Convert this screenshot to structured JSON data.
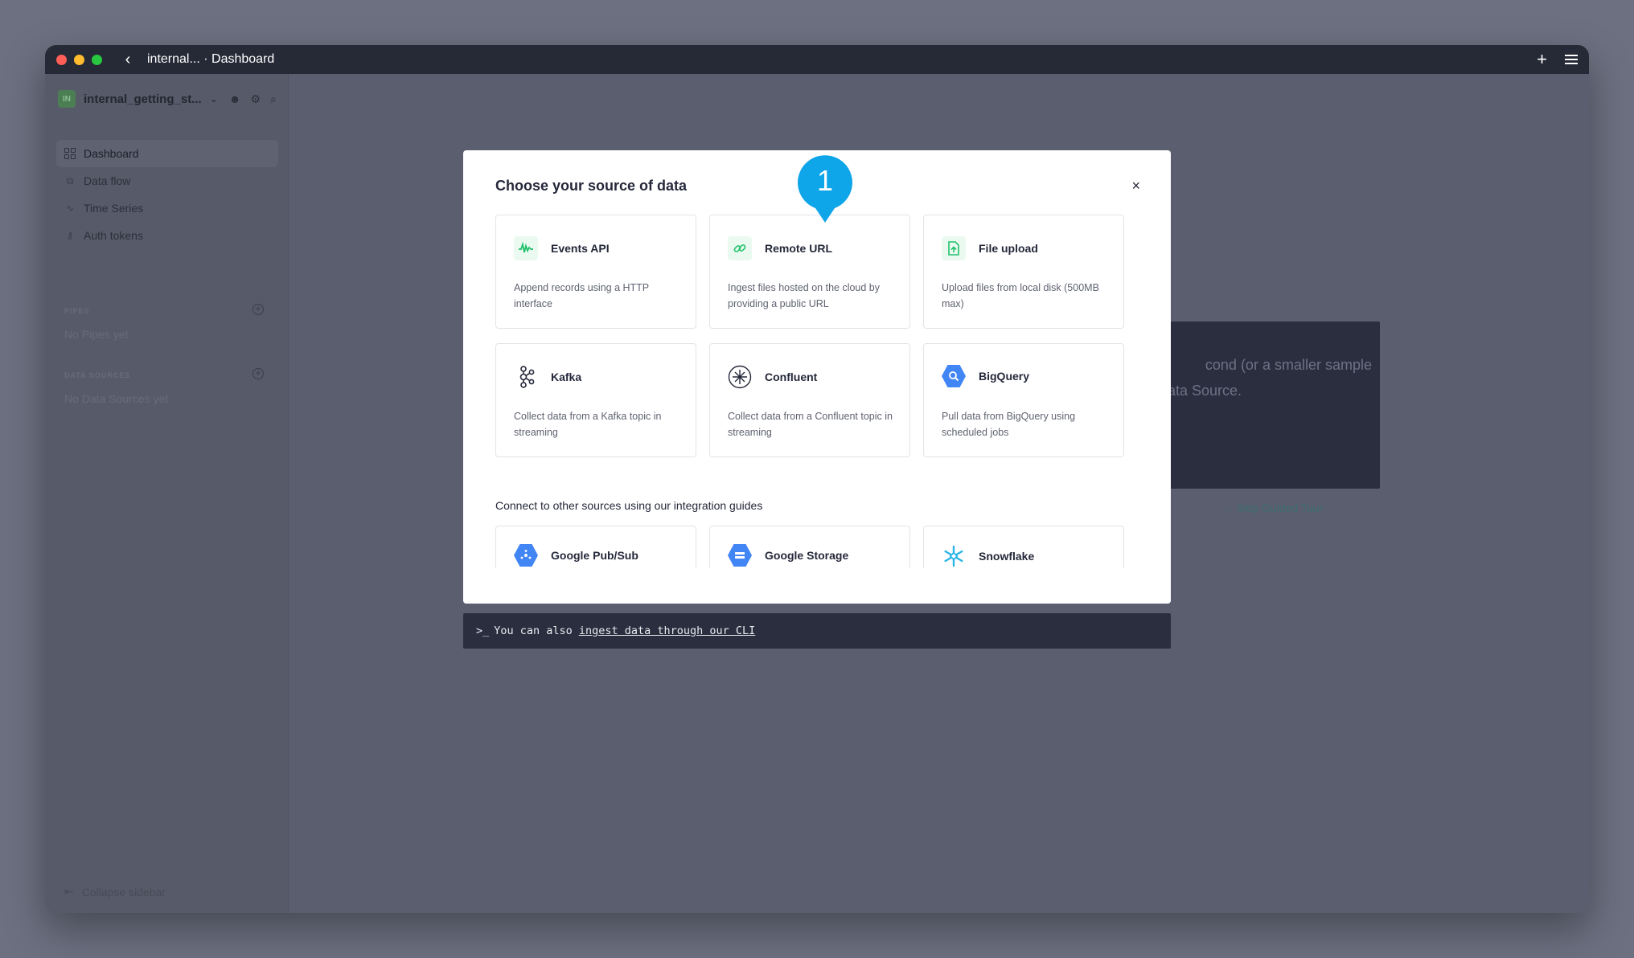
{
  "window": {
    "title": "internal... · Dashboard"
  },
  "sidebar": {
    "workspace_badge": "IN",
    "workspace_name": "internal_getting_st...",
    "nav": [
      {
        "label": "Dashboard",
        "icon": "dashboard-icon"
      },
      {
        "label": "Data flow",
        "icon": "data-flow-icon"
      },
      {
        "label": "Time Series",
        "icon": "time-series-icon"
      },
      {
        "label": "Auth tokens",
        "icon": "auth-tokens-icon"
      }
    ],
    "pipes_heading": "PIPES",
    "pipes_empty": "No Pipes yet",
    "datasources_heading": "DATA SOURCES",
    "datasources_empty": "No Data Sources yet",
    "collapse_label": "Collapse sidebar"
  },
  "background": {
    "card_line1": "cond (or a smaller sample",
    "card_line2": "ata Source.",
    "skip_label": "Skip Guided Tour"
  },
  "modal": {
    "title": "Choose your source of data",
    "close_glyph": "×",
    "sources": [
      {
        "title": "Events API",
        "desc": "Append records using a HTTP interface",
        "icon": "events-api-icon"
      },
      {
        "title": "Remote URL",
        "desc": "Ingest files hosted on the cloud by providing a public URL",
        "icon": "link-icon"
      },
      {
        "title": "File upload",
        "desc": "Upload files from local disk (500MB max)",
        "icon": "file-upload-icon"
      },
      {
        "title": "Kafka",
        "desc": "Collect data from a Kafka topic in streaming",
        "icon": "kafka-icon"
      },
      {
        "title": "Confluent",
        "desc": "Collect data from a Confluent topic in streaming",
        "icon": "confluent-icon"
      },
      {
        "title": "BigQuery",
        "desc": "Pull data from BigQuery using scheduled jobs",
        "icon": "bigquery-icon"
      }
    ],
    "connect_label": "Connect to other sources using our integration guides",
    "integrations": [
      {
        "title": "Google Pub/Sub",
        "icon": "google-pubsub-icon"
      },
      {
        "title": "Google Storage",
        "icon": "google-storage-icon"
      },
      {
        "title": "Snowflake",
        "icon": "snowflake-icon"
      }
    ]
  },
  "cli": {
    "prompt": ">_",
    "text": "You can also",
    "link": "ingest data through our CLI"
  },
  "tour": {
    "step": "1",
    "color": "#0fa5e9"
  }
}
